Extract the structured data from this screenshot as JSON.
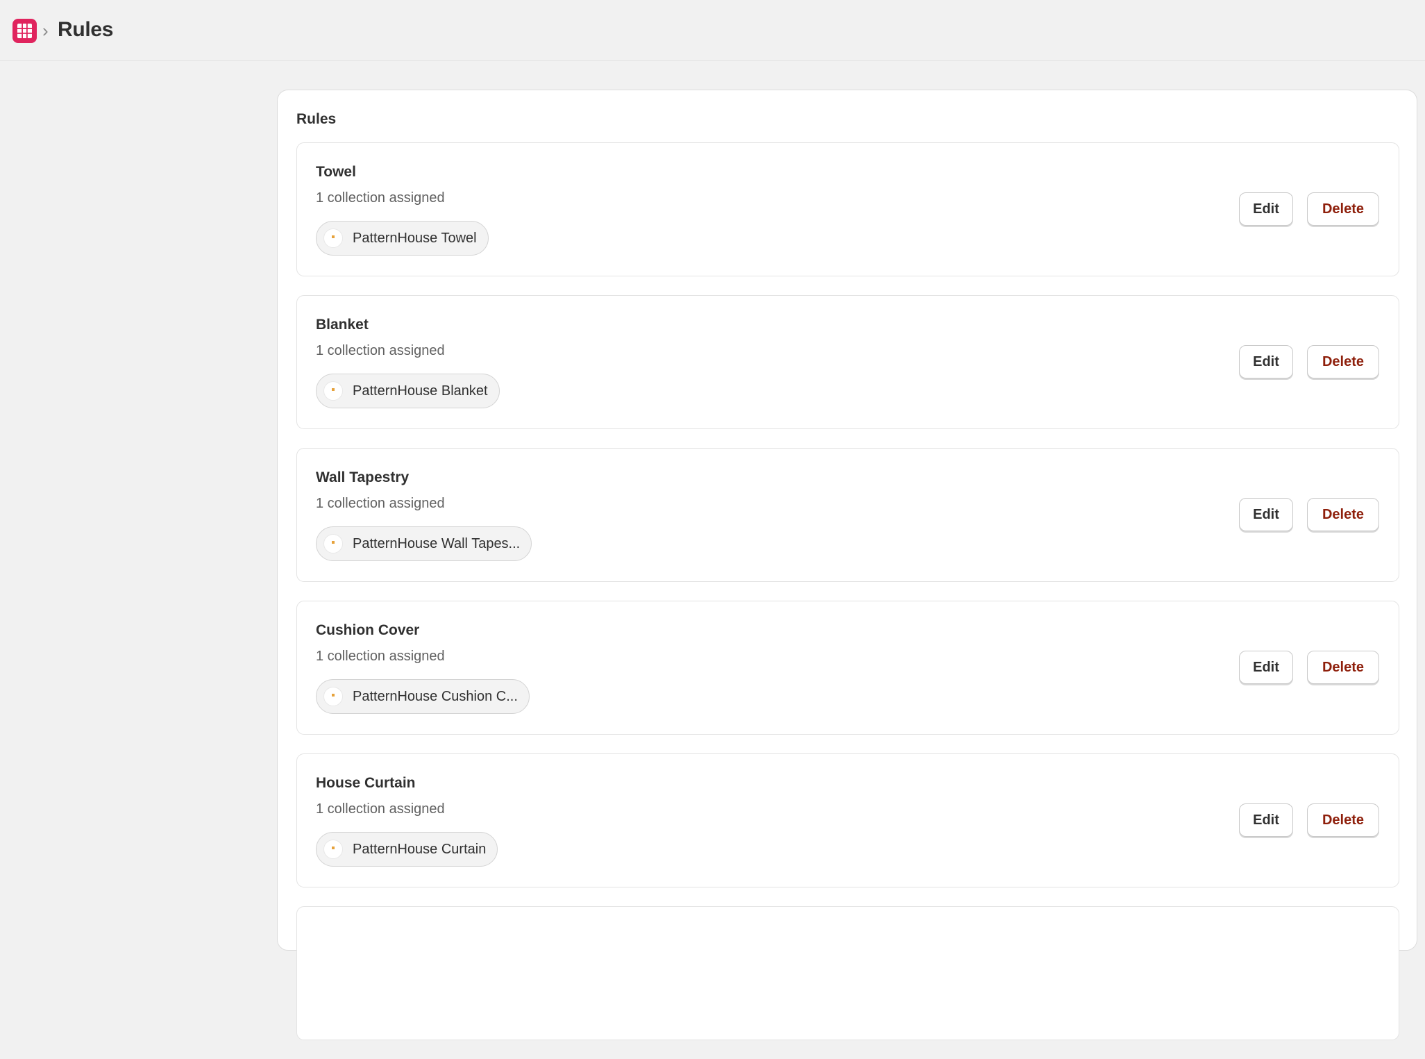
{
  "header": {
    "breadcrumb_separator": "›",
    "title": "Rules",
    "app_icon": "grid-icon",
    "app_icon_color": "#e0245e"
  },
  "panel": {
    "title": "Rules"
  },
  "actions": {
    "edit_label": "Edit",
    "delete_label": "Delete",
    "delete_color": "#8e1f0b"
  },
  "rules": [
    {
      "name": "Towel",
      "count_text": "1 collection assigned",
      "collection": "PatternHouse Towel"
    },
    {
      "name": "Blanket",
      "count_text": "1 collection assigned",
      "collection": "PatternHouse Blanket"
    },
    {
      "name": "Wall Tapestry",
      "count_text": "1 collection assigned",
      "collection": "PatternHouse Wall Tapes..."
    },
    {
      "name": "Cushion Cover",
      "count_text": "1 collection assigned",
      "collection": "PatternHouse Cushion C..."
    },
    {
      "name": "House Curtain",
      "count_text": "1 collection assigned",
      "collection": "PatternHouse Curtain"
    }
  ]
}
